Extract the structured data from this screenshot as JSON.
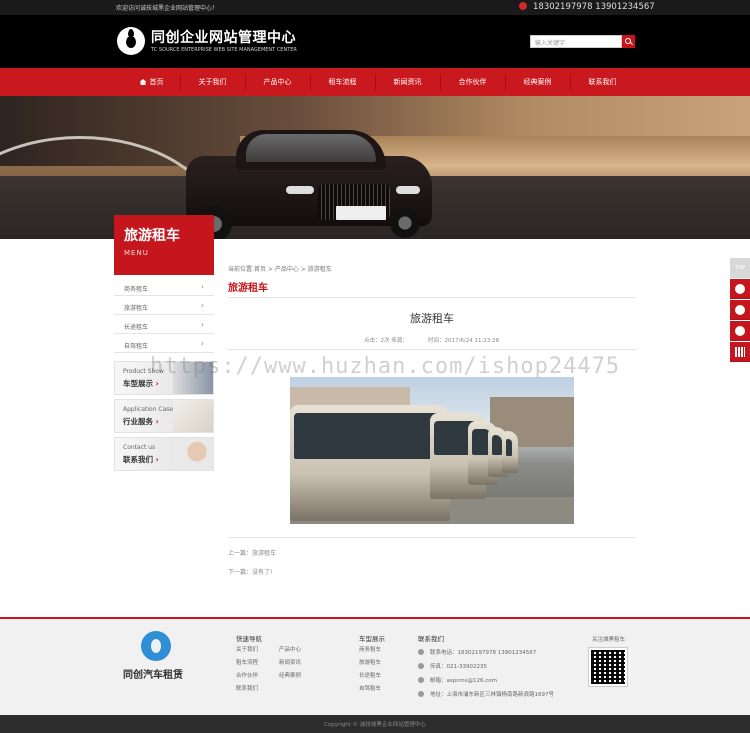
{
  "topbar": {
    "welcome": "欢迎访问诚技城黑企业网站管理中心！",
    "phones": "18302197978 13901234567"
  },
  "header": {
    "brand_title": "同创企业网站管理中心",
    "brand_sub": "TC SOURCE ENTERPRISE WEB SITE MANAGEMENT CENTER",
    "search_placeholder": "输入关键字"
  },
  "nav": {
    "items": [
      "首页",
      "关于我们",
      "产品中心",
      "租车流程",
      "新闻资讯",
      "合作伙伴",
      "经典案例",
      "联系我们"
    ]
  },
  "sidebar": {
    "title": "旅游租车",
    "subtitle": "MENU",
    "menu": [
      "商务租车",
      "旅游租车",
      "长途租车",
      "自驾租车"
    ],
    "promos": [
      {
        "en": "Product Show",
        "zh": "车型展示"
      },
      {
        "en": "Application Case",
        "zh": "行业服务"
      },
      {
        "en": "Contact us",
        "zh": "联系我们"
      }
    ]
  },
  "content": {
    "breadcrumb": "当前位置:首页 > 产品中心 > 旅游租车",
    "section_title": "旅游租车",
    "article_title": "旅游租车",
    "meta_views": "点击：2次 来源：",
    "meta_time": "时间：2017/6/24 11:23:28",
    "prev": "上一篇：旅游租车",
    "next": "下一篇：没有了!"
  },
  "watermark": "https://www.huzhan.com/ishop24475",
  "float": {
    "top_label": "TOP"
  },
  "footer": {
    "brand": "同创汽车租赁",
    "quick_nav_title": "快速导航",
    "quick_nav": [
      "关于我们",
      "产品中心",
      "租车流程",
      "新闻资讯",
      "合作伙伴",
      "经典案例",
      "联系我们"
    ],
    "car_title": "车型展示",
    "car_links": [
      "商务租车",
      "旅游租车",
      "长途租车",
      "自驾租车"
    ],
    "contact_title": "联系我们",
    "contact_phone": "联系电话：18302197978 13901234567",
    "contact_fax": "传真：021-33902235",
    "contact_email": "邮箱：aspcms@126.com",
    "contact_addr": "地址：上海市浦东新区三林镇杨南路新浪路1697号",
    "follow_title": "关注城黑租车",
    "copyright": "Copyright © 诚技城黑企业网站管理中心"
  },
  "colors": {
    "accent": "#c4161c",
    "top_bar": "#1a1a1a",
    "footer_bar": "#2d2d2d"
  }
}
